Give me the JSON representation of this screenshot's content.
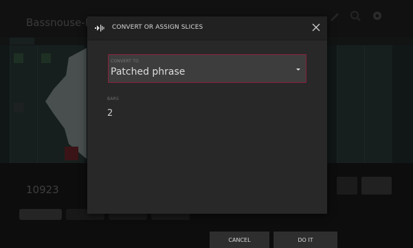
{
  "dialog": {
    "title": "CONVERT OR ASSIGN SLICES",
    "icon": "slice-convert-icon",
    "close_icon": "close-icon",
    "convert_to": {
      "label": "CONVERT TO",
      "value": "Patched phrase"
    },
    "bars": {
      "label": "BARS",
      "value": "2"
    },
    "accent_color": "#8a1f3a"
  },
  "footer": {
    "cancel_label": "CANCEL",
    "do_it_label": "DO IT"
  },
  "background_app": {
    "title": "Bassnouse-Fx",
    "value": "10923"
  }
}
